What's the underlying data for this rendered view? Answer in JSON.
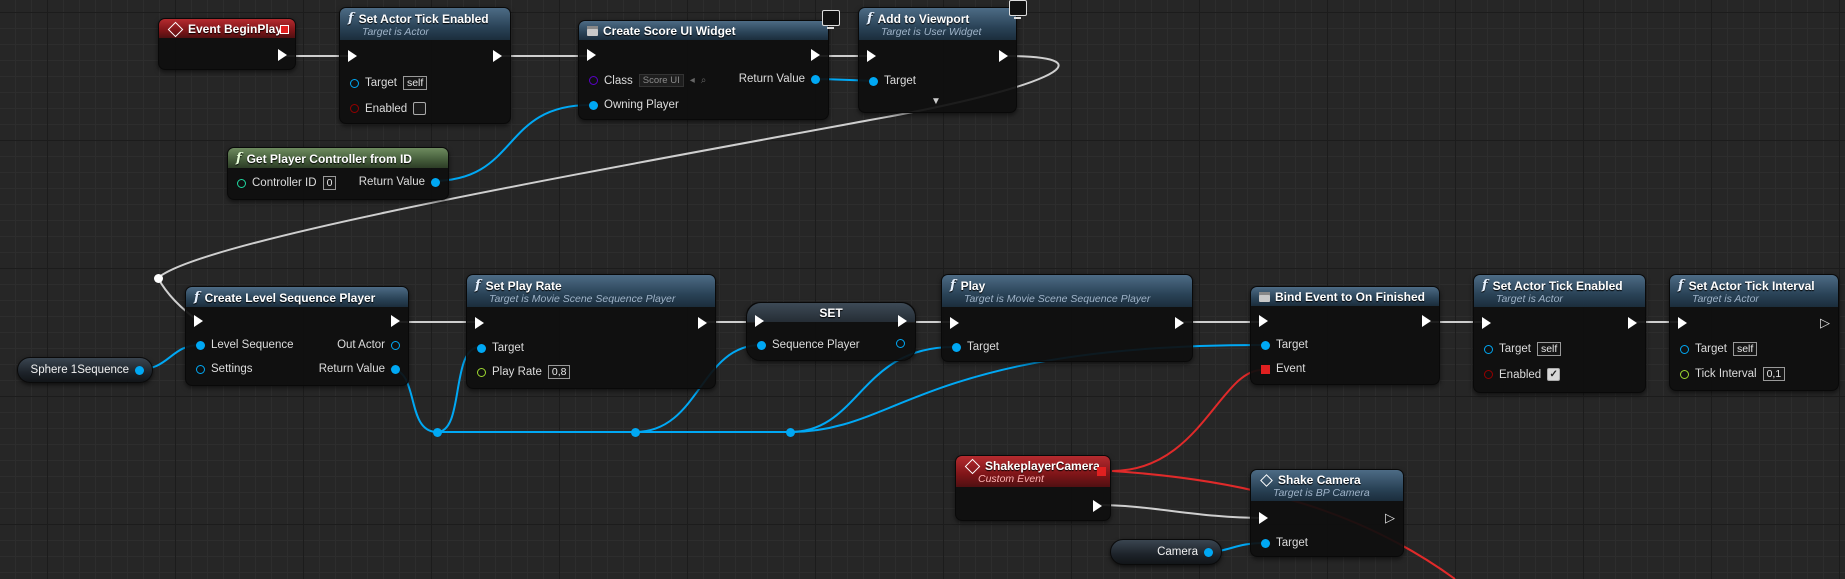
{
  "nodes": {
    "event_begin_play": {
      "title": "Event BeginPlay"
    },
    "set_tick_1": {
      "title": "Set Actor Tick Enabled",
      "subtitle": "Target is Actor",
      "target_label": "Target",
      "target_value": "self",
      "enabled_label": "Enabled",
      "enabled_checked": false
    },
    "create_widget": {
      "title": "Create Score UI Widget",
      "class_label": "Class",
      "class_value": "Score UI",
      "return_label": "Return Value",
      "owning_label": "Owning Player"
    },
    "add_viewport": {
      "title": "Add to Viewport",
      "subtitle": "Target is User Widget",
      "target_label": "Target"
    },
    "get_pc": {
      "title": "Get Player Controller from ID",
      "controller_label": "Controller ID",
      "controller_value": "0",
      "return_label": "Return Value"
    },
    "create_seq_player": {
      "title": "Create Level Sequence Player",
      "level_seq_label": "Level Sequence",
      "settings_label": "Settings",
      "out_actor_label": "Out Actor",
      "return_label": "Return Value"
    },
    "set_play_rate": {
      "title": "Set Play Rate",
      "subtitle": "Target is Movie Scene Sequence Player",
      "target_label": "Target",
      "play_rate_label": "Play Rate",
      "play_rate_value": "0,8"
    },
    "set_var": {
      "title": "SET",
      "seq_player_label": "Sequence Player"
    },
    "play": {
      "title": "Play",
      "subtitle": "Target is Movie Scene Sequence Player",
      "target_label": "Target"
    },
    "bind_event": {
      "title": "Bind Event to On Finished",
      "target_label": "Target",
      "event_label": "Event"
    },
    "set_tick_2": {
      "title": "Set Actor Tick Enabled",
      "subtitle": "Target is Actor",
      "target_label": "Target",
      "target_value": "self",
      "enabled_label": "Enabled",
      "enabled_checked": true
    },
    "set_tick_interval": {
      "title": "Set Actor Tick Interval",
      "subtitle": "Target is Actor",
      "target_label": "Target",
      "target_value": "self",
      "tick_label": "Tick Interval",
      "tick_value": "0,1"
    },
    "shake_event": {
      "title": "ShakeplayerCamera",
      "subtitle": "Custom Event"
    },
    "shake_camera": {
      "title": "Shake Camera",
      "subtitle": "Target is BP Camera",
      "target_label": "Target"
    },
    "sphere_var": {
      "label": "Sphere 1Sequence"
    },
    "camera_var": {
      "label": "Camera"
    }
  },
  "colors": {
    "exec_wire": "#d8d8d8",
    "object_wire": "#00a8f4",
    "delegate_wire": "#e02a2a",
    "function_header": "#2a4357",
    "event_header": "#7e1518",
    "pure_header": "#445c3a"
  },
  "icons": {
    "function": "function-f-icon",
    "event": "event-diamond-icon",
    "widget": "widget-box-icon",
    "client_only": "monitor-icon"
  }
}
